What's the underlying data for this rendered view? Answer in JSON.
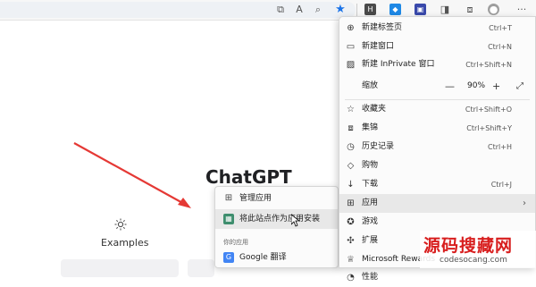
{
  "colors": {
    "accent": "#1a73e8",
    "arrow": "#e53935",
    "watermark": "#d81e1e"
  },
  "toolbar": {
    "icons": [
      "share-icon",
      "read-aloud-icon",
      "zoom-icon",
      "favorite-star-icon"
    ],
    "extensions": [
      "extension-a",
      "extension-b",
      "extension-c",
      "sidebar-icon",
      "collections-icon",
      "profile-icon"
    ],
    "more_label": "···"
  },
  "page": {
    "title": "ChatGPT",
    "examples_label": "Examples"
  },
  "menu": {
    "new_tab": {
      "label": "新建标签页",
      "shortcut": "Ctrl+T"
    },
    "new_window": {
      "label": "新建窗口",
      "shortcut": "Ctrl+N"
    },
    "new_inprivate": {
      "label": "新建 InPrivate 窗口",
      "shortcut": "Ctrl+Shift+N"
    },
    "zoom": {
      "label": "缩放",
      "minus": "—",
      "value": "90%",
      "plus": "+",
      "expand": "⤢"
    },
    "favorites": {
      "label": "收藏夹",
      "shortcut": "Ctrl+Shift+O"
    },
    "collections": {
      "label": "集锦",
      "shortcut": "Ctrl+Shift+Y"
    },
    "history": {
      "label": "历史记录",
      "shortcut": "Ctrl+H"
    },
    "shopping": {
      "label": "购物"
    },
    "downloads": {
      "label": "下载",
      "shortcut": "Ctrl+J"
    },
    "apps": {
      "label": "应用",
      "chevron": "›"
    },
    "games": {
      "label": "游戏"
    },
    "extensions": {
      "label": "扩展"
    },
    "rewards": {
      "label": "Microsoft Rewards"
    },
    "performance": {
      "label": "性能"
    }
  },
  "submenu": {
    "manage_apps": "管理应用",
    "install_site": "将此站点作为应用安装",
    "your_apps_heading": "你的应用",
    "google_translate": "Google 翻译"
  },
  "watermark": {
    "cn": "源码搜藏网",
    "url": "codesocang.com"
  }
}
